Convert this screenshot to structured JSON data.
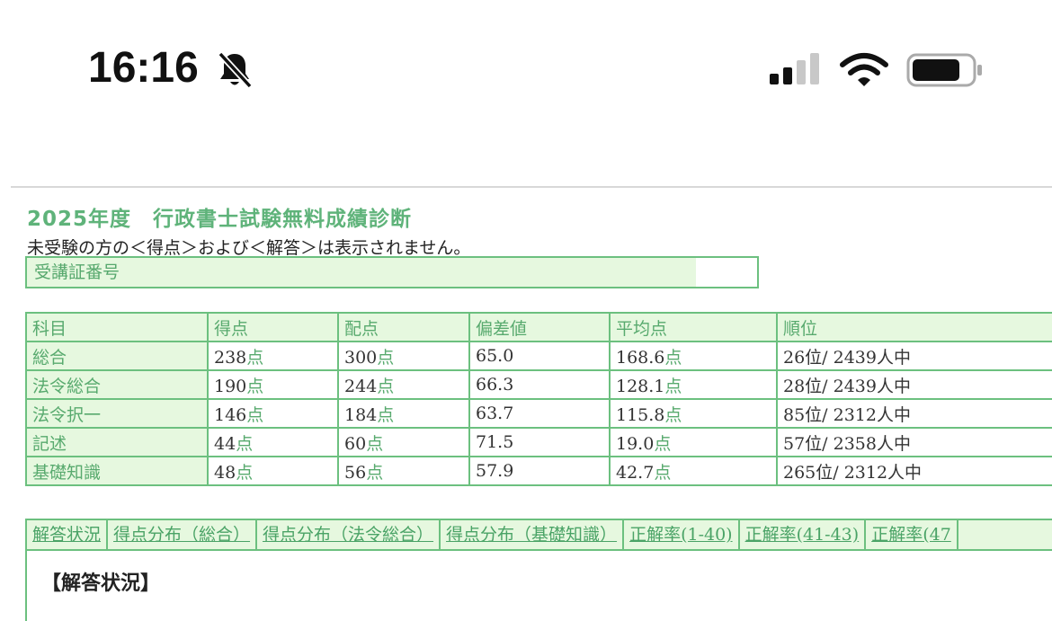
{
  "status_bar": {
    "time": "16:16",
    "icons": [
      "bell-slash-icon",
      "cellular-signal-icon",
      "wifi-icon",
      "battery-icon"
    ]
  },
  "page": {
    "title": "2025年度　行政書士試験無料成績診断",
    "notice": "未受験の方の＜得点＞および＜解答＞は表示されません。",
    "id_label": "受講証番号",
    "id_value": ""
  },
  "scores": {
    "headers": [
      "科目",
      "得点",
      "配点",
      "偏差値",
      "平均点",
      "順位"
    ],
    "unit_point": "点",
    "rows": [
      {
        "subject": "総合",
        "score": "238",
        "max": "300",
        "deviation": "65.0",
        "average": "168.6",
        "rank": "26位/ 2439人中"
      },
      {
        "subject": "法令総合",
        "score": "190",
        "max": "244",
        "deviation": "66.3",
        "average": "128.1",
        "rank": "28位/ 2439人中"
      },
      {
        "subject": "法令択一",
        "score": "146",
        "max": "184",
        "deviation": "63.7",
        "average": "115.8",
        "rank": "85位/ 2312人中"
      },
      {
        "subject": "記述",
        "score": "44",
        "max": "60",
        "deviation": "71.5",
        "average": "19.0",
        "rank": "57位/ 2358人中"
      },
      {
        "subject": "基礎知識",
        "score": "48",
        "max": "56",
        "deviation": "57.9",
        "average": "42.7",
        "rank": "265位/ 2312人中"
      }
    ]
  },
  "tabs": [
    "解答状況",
    "得点分布（総合）",
    "得点分布（法令総合）",
    "得点分布（基礎知識）",
    "正解率(1-40)",
    "正解率(41-43)",
    "正解率(47"
  ],
  "panel": {
    "heading": "【解答状況】"
  },
  "colors": {
    "accent_green": "#5fb37a",
    "border_green": "#6cc07f",
    "cell_bg": "#e6f8df"
  }
}
